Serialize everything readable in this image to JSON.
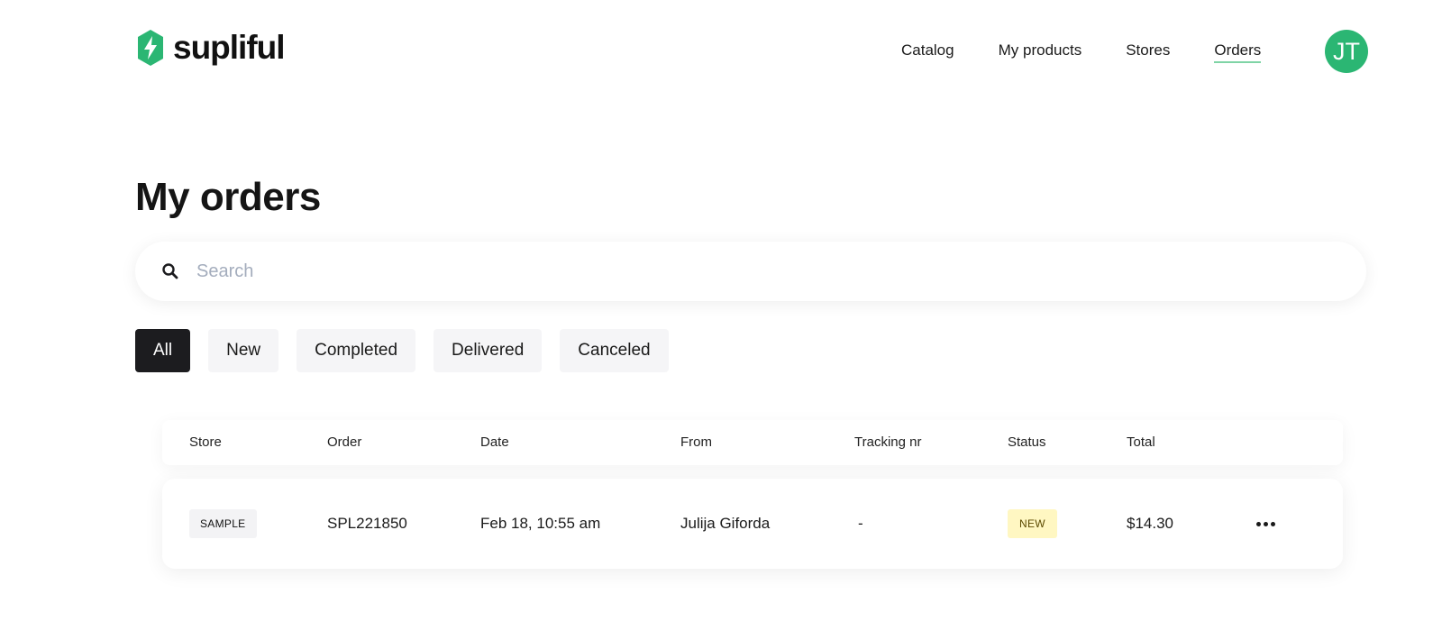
{
  "brand": {
    "name": "supliful",
    "color": "#2bb673"
  },
  "nav": {
    "items": [
      {
        "label": "Catalog",
        "active": false
      },
      {
        "label": "My products",
        "active": false
      },
      {
        "label": "Stores",
        "active": false
      },
      {
        "label": "Orders",
        "active": true
      }
    ],
    "active_underline_color": "#7fd4a6"
  },
  "user": {
    "initials": "JT",
    "avatar_color": "#2bb673"
  },
  "page": {
    "title": "My orders"
  },
  "search": {
    "placeholder": "Search",
    "value": "",
    "icon": "search-icon"
  },
  "filters": {
    "items": [
      {
        "label": "All",
        "active": true
      },
      {
        "label": "New",
        "active": false
      },
      {
        "label": "Completed",
        "active": false
      },
      {
        "label": "Delivered",
        "active": false
      },
      {
        "label": "Canceled",
        "active": false
      }
    ]
  },
  "table": {
    "headers": {
      "store": "Store",
      "order": "Order",
      "date": "Date",
      "from": "From",
      "tracking": "Tracking nr",
      "status": "Status",
      "total": "Total"
    },
    "rows": [
      {
        "store": "SAMPLE",
        "order": "SPL221850",
        "date": "Feb 18, 10:55 am",
        "from": "Julija Giforda",
        "tracking": "-",
        "status": "NEW",
        "status_color": "#fff7c2",
        "total": "$14.30",
        "actions_icon": "more-horizontal-icon"
      }
    ]
  }
}
